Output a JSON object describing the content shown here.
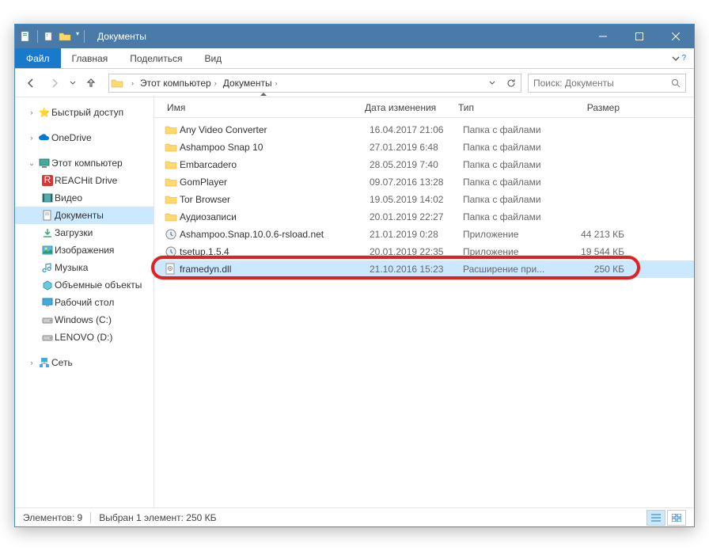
{
  "title": "Документы",
  "ribbon": {
    "file": "Файл",
    "tabs": [
      "Главная",
      "Поделиться",
      "Вид"
    ]
  },
  "breadcrumbs": [
    "Этот компьютер",
    "Документы"
  ],
  "search": {
    "placeholder": "Поиск: Документы"
  },
  "columns": {
    "name": "Имя",
    "date": "Дата изменения",
    "type": "Тип",
    "size": "Размер"
  },
  "nav": {
    "quick": "Быстрый доступ",
    "onedrive": "OneDrive",
    "thispc": "Этот компьютер",
    "children": [
      "REACHit Drive",
      "Видео",
      "Документы",
      "Загрузки",
      "Изображения",
      "Музыка",
      "Объемные объекты",
      "Рабочий стол",
      "Windows (C:)",
      "LENOVO (D:)"
    ],
    "network": "Сеть"
  },
  "files": [
    {
      "icon": "folder",
      "name": "Any Video Converter",
      "date": "16.04.2017 21:06",
      "type": "Папка с файлами",
      "size": ""
    },
    {
      "icon": "folder",
      "name": "Ashampoo Snap 10",
      "date": "27.01.2019 6:48",
      "type": "Папка с файлами",
      "size": ""
    },
    {
      "icon": "folder",
      "name": "Embarcadero",
      "date": "28.05.2019 7:40",
      "type": "Папка с файлами",
      "size": ""
    },
    {
      "icon": "folder",
      "name": "GomPlayer",
      "date": "09.07.2016 13:28",
      "type": "Папка с файлами",
      "size": ""
    },
    {
      "icon": "folder",
      "name": "Tor Browser",
      "date": "19.05.2019 14:02",
      "type": "Папка с файлами",
      "size": ""
    },
    {
      "icon": "folder",
      "name": "Аудиозаписи",
      "date": "20.01.2019 22:27",
      "type": "Папка с файлами",
      "size": ""
    },
    {
      "icon": "app",
      "name": "Ashampoo.Snap.10.0.6-rsload.net",
      "date": "21.01.2019 0:28",
      "type": "Приложение",
      "size": "44 213 КБ"
    },
    {
      "icon": "app",
      "name": "tsetup.1.5.4",
      "date": "20.01.2019 22:35",
      "type": "Приложение",
      "size": "19 544 КБ"
    },
    {
      "icon": "dll",
      "name": "framedyn.dll",
      "date": "21.10.2016 15:23",
      "type": "Расширение при...",
      "size": "250 КБ",
      "selected": true
    }
  ],
  "status": {
    "count": "Элементов: 9",
    "selection": "Выбран 1 элемент: 250 КБ"
  }
}
